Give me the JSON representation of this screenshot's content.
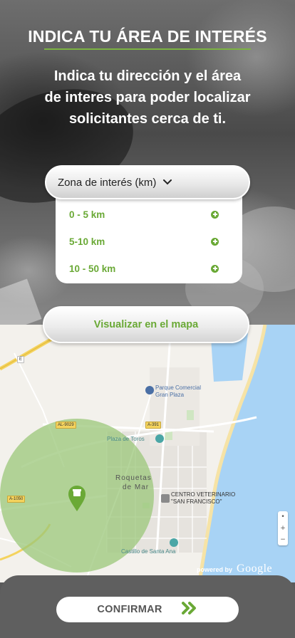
{
  "header": {
    "title": "INDICA TU ÁREA DE INTERÉS",
    "subtitle_line1": "Indica tu dirección y el área",
    "subtitle_line2": "de interes para poder localizar",
    "subtitle_line3": "solicitantes cerca de ti."
  },
  "zone_select": {
    "label": "Zona de interés (km)",
    "options": [
      {
        "label": "0 - 5 km"
      },
      {
        "label": "5-10 km"
      },
      {
        "label": "10 - 50 km"
      }
    ]
  },
  "map_button": {
    "label": "Visualizar en el mapa"
  },
  "map": {
    "labels": {
      "parque_comercial_1": "Parque Comercial",
      "parque_comercial_2": "Gran Plaza",
      "plaza_toros": "Plaza de Toros",
      "roquetas_1": "Roquetas",
      "roquetas_2": "de Mar",
      "veterinario_1": "CENTRO VETERINARIO",
      "veterinario_2": "\"SAN FRANCISCO\"",
      "castillo": "Castillo de Santa Ana"
    },
    "road_tags": {
      "e": "E",
      "al9029": "AL-9029",
      "a391": "A-391",
      "a1050": "A-1050",
      "left": "E"
    },
    "powered_by": "powered by",
    "google": "Google",
    "zoom_in": "+",
    "zoom_out": "−",
    "locate": "•",
    "colors": {
      "water": "#a8d3f5",
      "radius_circle": "#9bc77a",
      "marker": "#6aa936"
    }
  },
  "confirm_button": {
    "label": "CONFIRMAR"
  },
  "colors": {
    "accent_green": "#6aa936",
    "bar_gray": "#5f5f5f"
  }
}
